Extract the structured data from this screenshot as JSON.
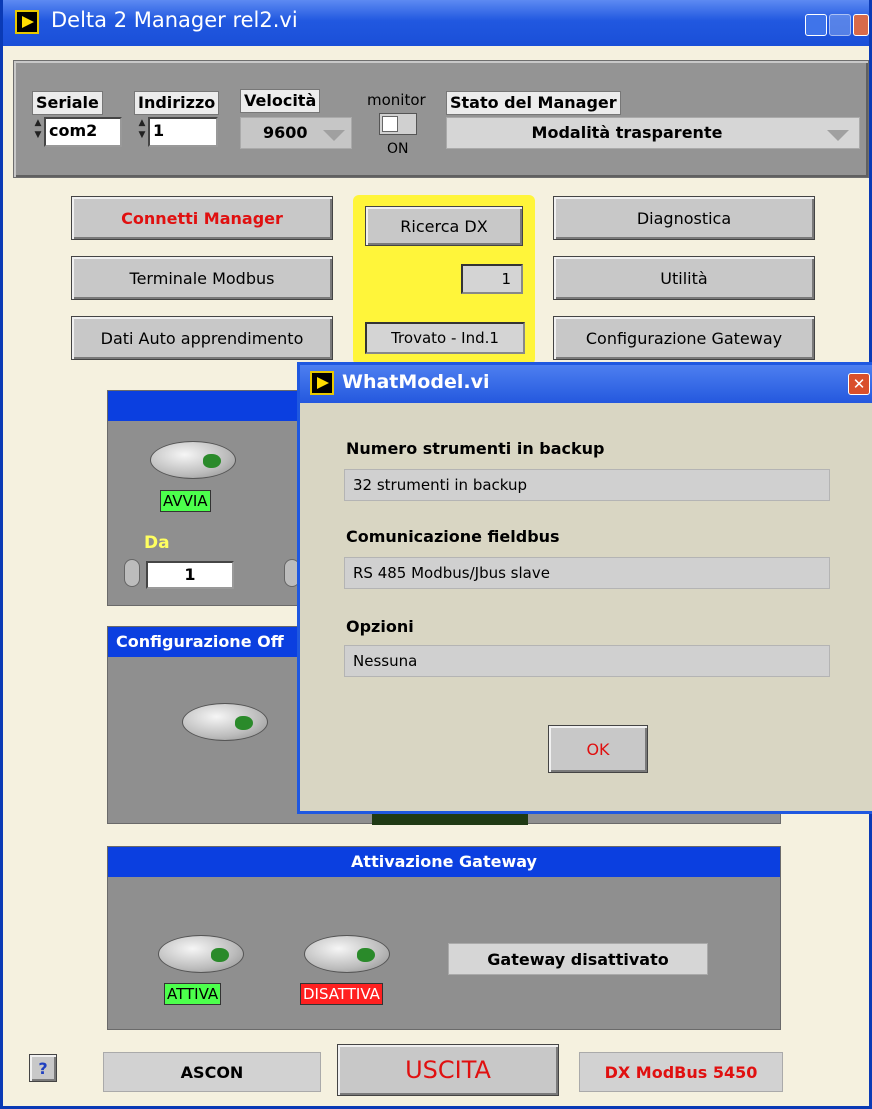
{
  "window": {
    "title": "Delta 2 Manager rel2.vi"
  },
  "top": {
    "seriale_label": "Seriale",
    "seriale_value": "com2",
    "indirizzo_label": "Indirizzo",
    "indirizzo_value": "1",
    "velocita_label": "Velocità",
    "velocita_value": "9600",
    "monitor_label": "monitor",
    "monitor_state": "ON",
    "stato_label": "Stato del Manager",
    "stato_value": "Modalità trasparente"
  },
  "buttons": {
    "connetti": "Connetti Manager",
    "terminale": "Terminale Modbus",
    "dati": "Dati Auto apprendimento",
    "ricerca": "Ricerca DX",
    "ricerca_count": "1",
    "trovato": "Trovato - Ind.1",
    "diagnostica": "Diagnostica",
    "utilita": "Utilità",
    "configurazione_gateway": "Configurazione Gateway"
  },
  "group1": {
    "avvia": "AVVIA",
    "da_label": "Da",
    "da_value": "1"
  },
  "group2": {
    "title": "Configurazione Off"
  },
  "gateway": {
    "title": "Attivazione Gateway",
    "attiva": "ATTIVA",
    "disattiva": "DISATTIVA",
    "status": "Gateway disattivato"
  },
  "footer": {
    "help": "?",
    "ascon": "ASCON",
    "uscita": "USCITA",
    "model": "DX ModBus  5450"
  },
  "dialog": {
    "title": "WhatModel.vi",
    "label1": "Numero strumenti in backup",
    "value1": "32 strumenti in backup",
    "label2": "Comunicazione fieldbus",
    "value2": "RS 485 Modbus/Jbus slave",
    "label3": "Opzioni",
    "value3": "Nessuna",
    "ok": "OK"
  },
  "colors": {
    "titlebar": "#2158e0",
    "panel_gray": "#8f8f8f",
    "group_header": "#0b3fe0",
    "highlight_yellow": "#fff53a",
    "accent_red": "#e01010",
    "badge_green": "#4cff4c"
  }
}
